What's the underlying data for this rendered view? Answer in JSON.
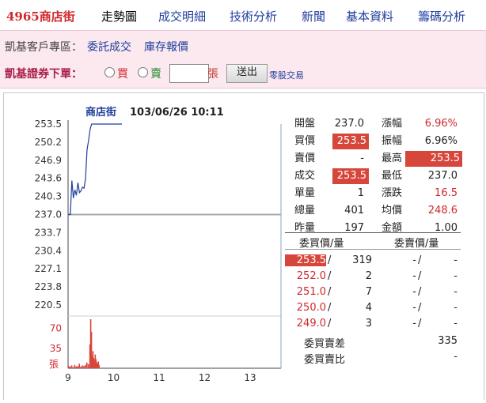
{
  "nav": {
    "stock_tab": "4965商店街",
    "tabs": [
      "走勢圖",
      "成交明細",
      "技術分析",
      "新聞",
      "基本資料",
      "籌碼分析"
    ]
  },
  "customer": {
    "label": "凱基客戶專區：",
    "links": [
      "委託成交",
      "庫存報價"
    ]
  },
  "order": {
    "title": "凱基證券下單：",
    "buy": "買",
    "sell": "賣",
    "qty_value": "",
    "unit": "張",
    "submit": "送出",
    "odd_lot": "零股交易"
  },
  "chart_data": {
    "type": "line",
    "title": "商店街",
    "datetime": "103/06/26 10:11",
    "price_ticks": [
      "253.5",
      "250.2",
      "246.9",
      "243.6",
      "240.3",
      "237.0",
      "233.7",
      "230.4",
      "227.1",
      "223.8",
      "220.5"
    ],
    "reference_price": 237.0,
    "ylim": [
      220.5,
      253.5
    ],
    "x_ticks": [
      "9",
      "10",
      "11",
      "12",
      "13"
    ],
    "volume_ticks": [
      "70",
      "35"
    ],
    "volume_unit": "張",
    "price_series": {
      "x_minutes": [
        0,
        3,
        5,
        7,
        9,
        11,
        13,
        15,
        17,
        19,
        21,
        23,
        25,
        27,
        29,
        31,
        33,
        35,
        40,
        50,
        60,
        71
      ],
      "y": [
        237.0,
        237.0,
        243.2,
        240.0,
        241.5,
        240.5,
        242.8,
        241.0,
        241.3,
        242.0,
        241.8,
        243.5,
        248.8,
        250.5,
        252.5,
        253.5,
        253.5,
        253.5,
        253.5,
        253.5,
        253.5,
        253.5
      ]
    },
    "volume_series": {
      "x_minutes": [
        0,
        2,
        4,
        6,
        8,
        10,
        12,
        14,
        16,
        18,
        20,
        22,
        24,
        26,
        28,
        29,
        30,
        31,
        32,
        33,
        34,
        35,
        36,
        37,
        38,
        39,
        40
      ],
      "values": [
        4,
        3,
        5,
        2,
        6,
        3,
        4,
        8,
        3,
        5,
        4,
        6,
        10,
        7,
        42,
        86,
        64,
        22,
        30,
        18,
        14,
        24,
        16,
        10,
        8,
        12,
        6
      ]
    }
  },
  "quote": {
    "rows": [
      {
        "l1": "開盤",
        "v1": "237.0",
        "s1": "",
        "l2": "漲幅",
        "v2": "6.96%",
        "s2": "red"
      },
      {
        "l1": "買價",
        "v1": "253.5",
        "s1": "redbg",
        "l2": "振幅",
        "v2": "6.96%",
        "s2": ""
      },
      {
        "l1": "賣價",
        "v1": "-",
        "s1": "",
        "l2": "最高",
        "v2": "253.5",
        "s2": "redbg"
      },
      {
        "l1": "成交",
        "v1": "253.5",
        "s1": "redbg",
        "l2": "最低",
        "v2": "237.0",
        "s2": ""
      },
      {
        "l1": "單量",
        "v1": "1",
        "s1": "",
        "l2": "漲跌",
        "v2": "16.5",
        "s2": "red"
      },
      {
        "l1": "總量",
        "v1": "401",
        "s1": "",
        "l2": "均價",
        "v2": "248.6",
        "s2": "red"
      },
      {
        "l1": "昨量",
        "v1": "197",
        "s1": "",
        "l2": "金額",
        "v2": "1.00",
        "s2": ""
      }
    ]
  },
  "book": {
    "bid_header": "委買價/量",
    "ask_header": "委賣價/量",
    "rows": [
      {
        "bid_price": "253.5",
        "bid_qty": "319",
        "ask_price": "-",
        "ask_qty": "-"
      },
      {
        "bid_price": "252.0",
        "bid_qty": "2",
        "ask_price": "-",
        "ask_qty": "-"
      },
      {
        "bid_price": "251.0",
        "bid_qty": "7",
        "ask_price": "-",
        "ask_qty": "-"
      },
      {
        "bid_price": "250.0",
        "bid_qty": "4",
        "ask_price": "-",
        "ask_qty": "-"
      },
      {
        "bid_price": "249.0",
        "bid_qty": "3",
        "ask_price": "-",
        "ask_qty": "-"
      }
    ],
    "diff_label": "委買賣差",
    "diff_value": "335",
    "ratio_label": "委買賣比",
    "ratio_value": "-"
  },
  "colors": {
    "accent_red": "#d0282e",
    "price_line": "#1f3e9c",
    "volume_bar": "#d6463b",
    "pink_band": "#fce9ef"
  }
}
